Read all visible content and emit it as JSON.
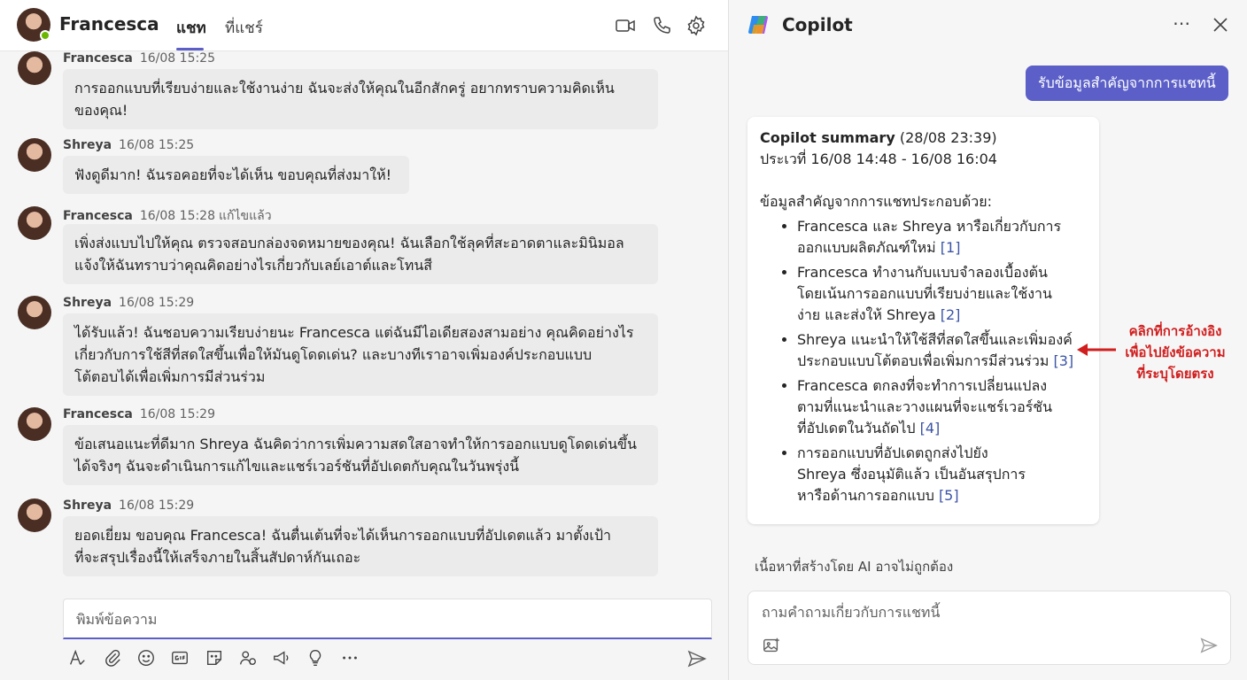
{
  "chat": {
    "contact_name": "Francesca",
    "tabs": [
      {
        "label": "แชท",
        "active": true
      },
      {
        "label": "ที่แชร์",
        "active": false
      }
    ],
    "header_icons": [
      "video-call-icon",
      "phone-call-icon",
      "settings-gear-icon"
    ],
    "messages": [
      {
        "sender": "Francesca",
        "time": "16/08 15:25",
        "edited": "",
        "lines": [
          "การออกแบบที่เรียบง่ายและใช้งานง่าย ฉันจะส่งให้คุณในอีกสักครู่ อยากทราบความคิดเห็น",
          "ของคุณ!"
        ]
      },
      {
        "sender": "Shreya",
        "time": "16/08 15:25",
        "edited": "",
        "lines": [
          "ฟังดูดีมาก! ฉันรอคอยที่จะได้เห็น ขอบคุณที่ส่งมาให้!"
        ]
      },
      {
        "sender": "Francesca",
        "time": "16/08 15:28",
        "edited": "แก้ไขแล้ว",
        "lines": [
          "เพิ่งส่งแบบไปให้คุณ ตรวจสอบกล่องจดหมายของคุณ! ฉันเลือกใช้ลุคที่สะอาดตาและมินิมอล",
          "แจ้งให้ฉันทราบว่าคุณคิดอย่างไรเกี่ยวกับเลย์เอาต์และโทนสี"
        ]
      },
      {
        "sender": "Shreya",
        "time": "16/08 15:29",
        "edited": "",
        "lines": [
          "ได้รับแล้ว! ฉันชอบความเรียบง่ายนะ Francesca แต่ฉันมีไอเดียสองสามอย่าง คุณคิดอย่างไร",
          "เกี่ยวกับการใช้สีที่สดใสขึ้นเพื่อให้มันดูโดดเด่น? และบางทีเราอาจเพิ่มองค์ประกอบแบบ",
          "โต้ตอบได้เพื่อเพิ่มการมีส่วนร่วม"
        ]
      },
      {
        "sender": "Francesca",
        "time": "16/08 15:29",
        "edited": "",
        "lines": [
          "ข้อเสนอแนะที่ดีมาก Shreya ฉันคิดว่าการเพิ่มความสดใสอาจทำให้การออกแบบดูโดดเด่นขึ้น",
          "ได้จริงๆ ฉันจะดำเนินการแก้ไขและแชร์เวอร์ชันที่อัปเดตกับคุณในวันพรุ่งนี้"
        ]
      },
      {
        "sender": "Shreya",
        "time": "16/08 15:29",
        "edited": "",
        "lines": [
          "ยอดเยี่ยม ขอบคุณ Francesca! ฉันตื่นเต้นที่จะได้เห็นการออกแบบที่อัปเดตแล้ว มาตั้งเป้า",
          "ที่จะสรุปเรื่องนี้ให้เสร็จภายในสิ้นสัปดาห์กันเถอะ"
        ]
      }
    ],
    "compose_placeholder": "พิมพ์ข้อความ",
    "toolbar_icons": [
      "format-text-icon",
      "attach-paperclip-icon",
      "emoji-icon",
      "gif-icon",
      "sticker-icon",
      "loop-component-icon",
      "praise-megaphone-icon",
      "ideas-lightbulb-icon",
      "more-options-icon"
    ],
    "accent_color": "#5b5fc7"
  },
  "copilot": {
    "title": "Copilot",
    "user_prompt": "รับข้อมูลสำคัญจากการแชทนี้",
    "summary": {
      "title": "Copilot summary",
      "title_date": "(28/08 23:39)",
      "range": "ประเวที่ 16/08 14:48 - 16/08 16:04",
      "intro": "ข้อมูลสำคัญจากการแชทประกอบด้วย:",
      "items": [
        {
          "lines": [
            "Francesca และ Shreya หารือเกี่ยวกับการ",
            "ออกแบบผลิตภัณฑ์ใหม่"
          ],
          "cite": "[1]"
        },
        {
          "lines": [
            "Francesca ทำงานกับแบบจำลองเบื้องต้น",
            "โดยเน้นการออกแบบที่เรียบง่ายและใช้งาน",
            "ง่าย และส่งให้ Shreya"
          ],
          "cite": "[2]"
        },
        {
          "lines": [
            "Shreya แนะนำให้ใช้สีที่สดใสขึ้นและเพิ่มองค์",
            "ประกอบแบบโต้ตอบเพื่อเพิ่มการมีส่วนร่วม"
          ],
          "cite": "[3]"
        },
        {
          "lines": [
            "Francesca ตกลงที่จะทำการเปลี่ยนแปลง",
            "ตามที่แนะนำและวางแผนที่จะแชร์เวอร์ชัน",
            "ที่อัปเดตในวันถัดไป"
          ],
          "cite": "[4]"
        },
        {
          "lines": [
            "การออกแบบที่อัปเดตถูกส่งไปยัง",
            "Shreya ซึ่งอนุมัติแล้ว เป็นอันสรุปการ",
            "หารือด้านการออกแบบ"
          ],
          "cite": "[5]"
        }
      ]
    },
    "annotation": [
      "คลิกที่การอ้างอิง",
      "เพื่อไปยังข้อความ",
      "ที่ระบุโดยตรง"
    ],
    "annotation_color": "#d11e1e",
    "disclaimer": "เนื้อหาที่สร้างโดย AI อาจไม่ถูกต้อง",
    "input_placeholder": "ถามคำถามเกี่ยวกับการแชทนี้"
  }
}
